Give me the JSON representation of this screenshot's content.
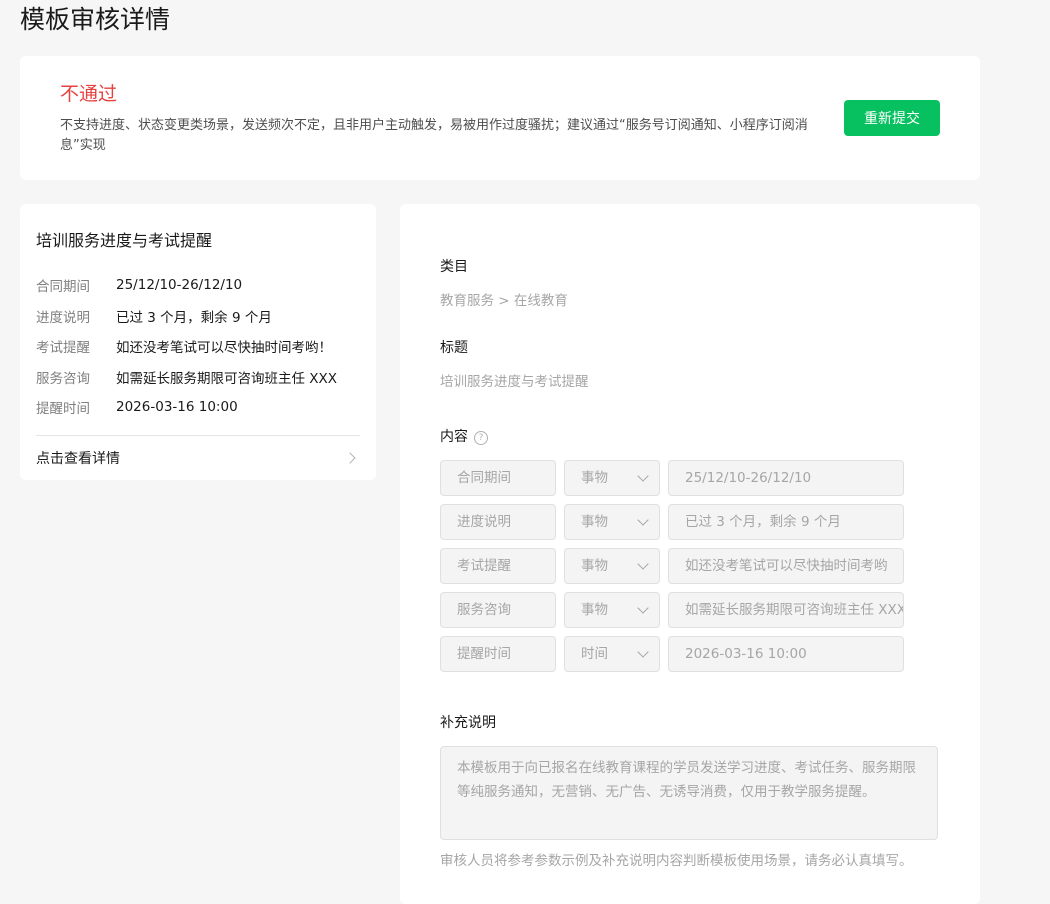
{
  "page": {
    "title": "模板审核详情"
  },
  "status": {
    "title": "不通过",
    "description": "不支持进度、状态变更类场景，发送频次不定，且非用户主动触发，易被用作过度骚扰；建议通过“服务号订阅通知、小程序订阅消息”实现",
    "resubmit_label": "重新提交"
  },
  "preview": {
    "title": "培训服务进度与考试提醒",
    "rows": [
      {
        "key": "合同期间",
        "value": "25/12/10-26/12/10"
      },
      {
        "key": "进度说明",
        "value": "已过 3 个月，剩余 9 个月"
      },
      {
        "key": "考试提醒",
        "value": "如还没考笔试可以尽快抽时间考哟！"
      },
      {
        "key": "服务咨询",
        "value": "如需延长服务期限可咨询班主任 XXX"
      },
      {
        "key": "提醒时间",
        "value": "2026-03-16 10:00"
      }
    ],
    "link_label": "点击查看详情"
  },
  "detail": {
    "category_label": "类目",
    "category_value": "教育服务 > 在线教育",
    "title_label": "标题",
    "title_value": "培训服务进度与考试提醒",
    "content_label": "内容",
    "help_icon": "?",
    "content_rows": [
      {
        "name": "合同期间",
        "type": "事物",
        "value": "25/12/10-26/12/10"
      },
      {
        "name": "进度说明",
        "type": "事物",
        "value": "已过 3 个月，剩余 9 个月"
      },
      {
        "name": "考试提醒",
        "type": "事物",
        "value": "如还没考笔试可以尽快抽时间考哟"
      },
      {
        "name": "服务咨询",
        "type": "事物",
        "value": "如需延长服务期限可咨询班主任 XXX"
      },
      {
        "name": "提醒时间",
        "type": "时间",
        "value": "2026-03-16 10:00"
      }
    ],
    "notes_label": "补充说明",
    "notes_value": "本模板用于向已报名在线教育课程的学员发送学习进度、考试任务、服务期限等纯服务通知，无营销、无广告、无诱导消费，仅用于教学服务提醒。",
    "notes_hint": "审核人员将参考参数示例及补充说明内容判断模板使用场景，请务必认真填写。"
  },
  "colors": {
    "reject": "#e64340",
    "primary": "#07c160"
  }
}
